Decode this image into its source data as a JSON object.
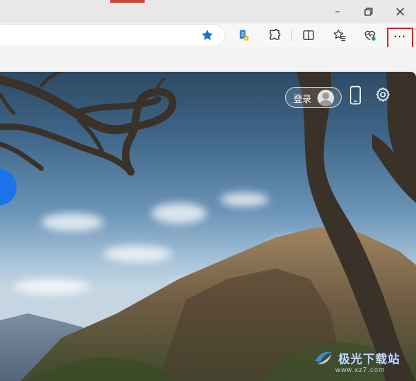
{
  "window": {
    "minimize_glyph": "–",
    "restore_glyph": "❐",
    "close_glyph": "✕"
  },
  "toolbar": {
    "icons": [
      "favorite-star-icon",
      "browser-essentials-icon",
      "extensions-icon",
      "split-screen-icon",
      "favorites-icon",
      "performance-icon"
    ],
    "more_label": "···",
    "highlight_color": "#e02020"
  },
  "newtab": {
    "signin_label": "登录",
    "accent_color": "#1a73e8"
  },
  "watermark": {
    "text": "极光下载站",
    "url": "www.xz7.com"
  }
}
